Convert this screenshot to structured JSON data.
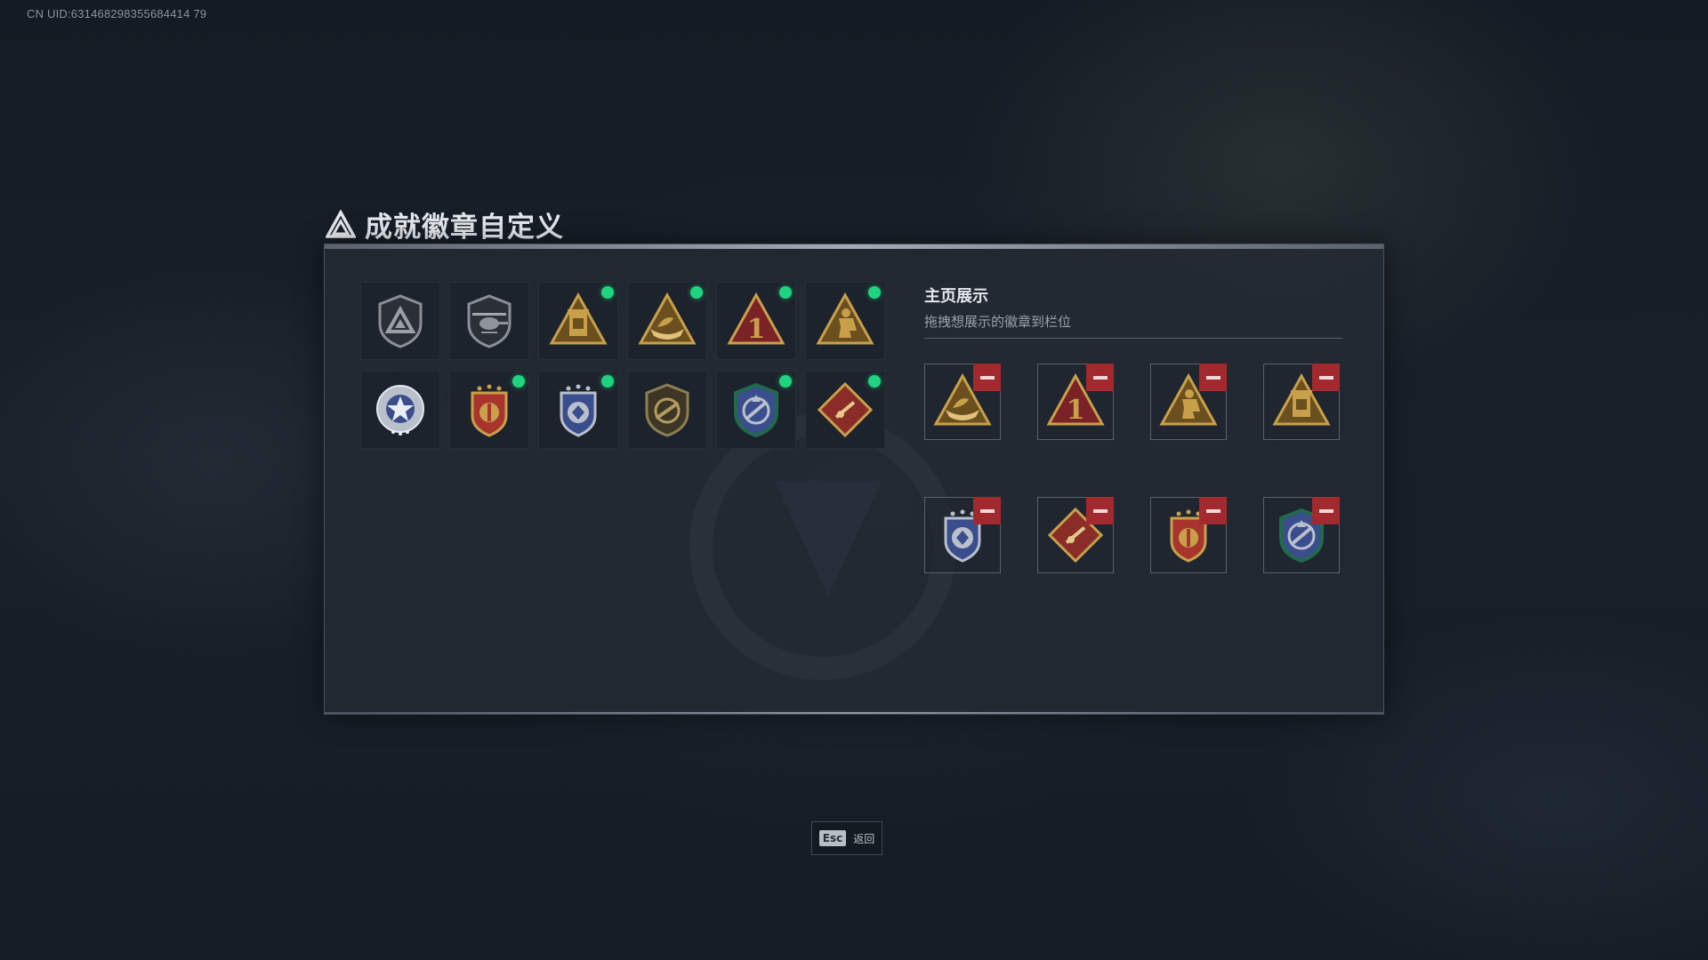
{
  "header": {
    "uid": "CN UID:631468298355684414 79"
  },
  "page": {
    "title": "成就徽章自定义",
    "title_icon": "triangle-logo-icon"
  },
  "collection": {
    "badges": [
      {
        "icon": "shield-triangle-badge-icon",
        "new": false
      },
      {
        "icon": "helicopter-shield-badge-icon",
        "new": false
      },
      {
        "icon": "lantern-triangle-badge-icon",
        "new": true
      },
      {
        "icon": "boat-triangle-badge-icon",
        "new": true
      },
      {
        "icon": "number-one-triangle-badge-icon",
        "new": true
      },
      {
        "icon": "figure-triangle-badge-icon",
        "new": true
      },
      {
        "icon": "silver-star-badge-icon",
        "new": false
      },
      {
        "icon": "gold-crest-badge-icon",
        "new": true
      },
      {
        "icon": "blue-crest-badge-icon",
        "new": true
      },
      {
        "icon": "rifle-shield-badge-icon",
        "new": false
      },
      {
        "icon": "green-arrows-badge-icon",
        "new": true
      },
      {
        "icon": "red-diamond-badge-icon",
        "new": true
      }
    ]
  },
  "display": {
    "title": "主页展示",
    "subtitle": "拖拽想展示的徽章到栏位",
    "slots": [
      {
        "icon": "boat-triangle-badge-icon"
      },
      {
        "icon": "number-one-triangle-badge-icon"
      },
      {
        "icon": "figure-triangle-badge-icon"
      },
      {
        "icon": "lantern-triangle-badge-icon"
      },
      {
        "icon": "blue-crest-badge-icon"
      },
      {
        "icon": "red-diamond-badge-icon"
      },
      {
        "icon": "gold-crest-badge-icon"
      },
      {
        "icon": "green-arrows-badge-icon"
      }
    ]
  },
  "footer": {
    "esc_key": "Esc",
    "esc_label": "返回"
  },
  "colors": {
    "accent_green": "#1fd47f",
    "remove_red": "#a22a2f",
    "gold": "#c8a04a"
  }
}
